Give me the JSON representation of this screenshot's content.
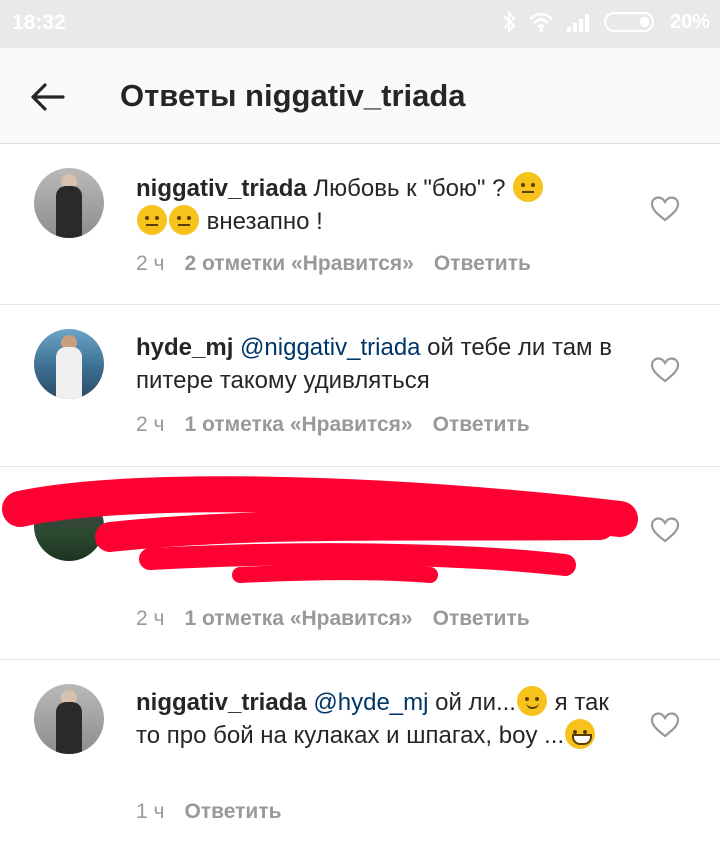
{
  "status_bar": {
    "time": "18:32",
    "battery": "20%"
  },
  "header": {
    "title": "Ответы niggativ_triada"
  },
  "comments": [
    {
      "username": "niggativ_triada",
      "text_a": " Любовь к \"бою\" ? ",
      "text_b": " внезапно !",
      "time": "2 ч",
      "likes": "2 отметки «Нравится»",
      "reply": "Ответить"
    },
    {
      "username": "hyde_mj",
      "mention": "@niggativ_triada",
      "text": " ой тебе ли там в питере такому удивляться",
      "time": "2 ч",
      "likes": "1 отметка «Нравится»",
      "reply": "Ответить"
    },
    {
      "time": "2 ч",
      "likes": "1 отметка «Нравится»",
      "reply": "Ответить"
    },
    {
      "username": "niggativ_triada",
      "mention": "@hyde_mj",
      "text_a": " ой ли...",
      "text_b": " я так то про бой на кулаках и шпагах, boy ...",
      "time": "1 ч",
      "reply": "Ответить"
    }
  ],
  "colors": {
    "accent_link": "#003569",
    "meta_grey": "#999999",
    "redaction": "#ff0033"
  }
}
